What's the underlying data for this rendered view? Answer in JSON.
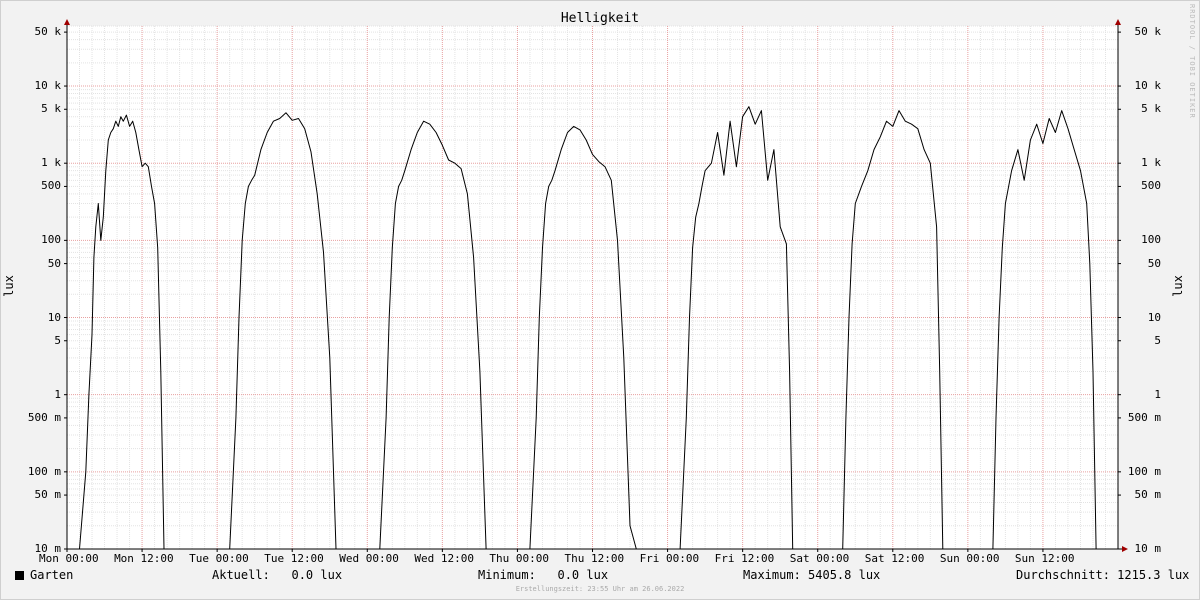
{
  "chart_data": {
    "type": "line",
    "title": "Helligkeit",
    "ylabel": "lux",
    "yscale": "log",
    "ylim": [
      0.01,
      60000
    ],
    "grid": true,
    "x_ticks": [
      "Mon 00:00",
      "Mon 12:00",
      "Tue 00:00",
      "Tue 12:00",
      "Wed 00:00",
      "Wed 12:00",
      "Thu 00:00",
      "Thu 12:00",
      "Fri 00:00",
      "Fri 12:00",
      "Sat 00:00",
      "Sat 12:00",
      "Sun 00:00",
      "Sun 12:00"
    ],
    "y_ticks": [
      {
        "value": 50000,
        "label": "50 k"
      },
      {
        "value": 10000,
        "label": "10 k"
      },
      {
        "value": 5000,
        "label": "5 k"
      },
      {
        "value": 1000,
        "label": "1 k"
      },
      {
        "value": 500,
        "label": "500"
      },
      {
        "value": 100,
        "label": "100"
      },
      {
        "value": 50,
        "label": "50"
      },
      {
        "value": 10,
        "label": "10"
      },
      {
        "value": 5,
        "label": "5"
      },
      {
        "value": 1,
        "label": "1"
      },
      {
        "value": 0.5,
        "label": "500 m"
      },
      {
        "value": 0.1,
        "label": "100 m"
      },
      {
        "value": 0.05,
        "label": "50 m"
      },
      {
        "value": 0.01,
        "label": "10 m"
      }
    ],
    "series": [
      {
        "name": "Garten",
        "color": "#000000",
        "x_hours": [
          0,
          2,
          3,
          3.5,
          4,
          4.3,
          4.6,
          5,
          5.4,
          5.8,
          6.2,
          6.6,
          7,
          7.4,
          7.8,
          8.2,
          8.6,
          9,
          9.5,
          10,
          10.5,
          11,
          11.5,
          12,
          12.5,
          13,
          13.5,
          14,
          14.5,
          15,
          15.5,
          16,
          16.5,
          17,
          17.5,
          18,
          18.5,
          19,
          19.5,
          20,
          20.5,
          21,
          21.5,
          22,
          26,
          27,
          27.5,
          28,
          28.5,
          29,
          29.5,
          30,
          31,
          32,
          33,
          34,
          35,
          36,
          37,
          38,
          39,
          40,
          41,
          42,
          43,
          43.5,
          44,
          44.5,
          45,
          45.5,
          46,
          50,
          51,
          51.5,
          52,
          52.5,
          53,
          53.5,
          54,
          55,
          56,
          57,
          58,
          59,
          60,
          61,
          62,
          63,
          64,
          65,
          66,
          67,
          67.5,
          68,
          68.5,
          69,
          69.5,
          70,
          74,
          75,
          75.5,
          76,
          76.5,
          77,
          77.5,
          78,
          79,
          80,
          81,
          82,
          83,
          84,
          85,
          86,
          87,
          88,
          89,
          90,
          91,
          91.5,
          92,
          92.5,
          93,
          93.5,
          94,
          98,
          99,
          99.5,
          100,
          100.5,
          101,
          101.5,
          102,
          103,
          104,
          105,
          106,
          107,
          108,
          109,
          110,
          111,
          112,
          113,
          114,
          115,
          115.5,
          116,
          116.5,
          117,
          117.5,
          118,
          122,
          123,
          123.5,
          124,
          124.5,
          125,
          125.5,
          126,
          127,
          128,
          129,
          130,
          131,
          132,
          133,
          134,
          135,
          136,
          137,
          138,
          139,
          139.5,
          140,
          140.5,
          141,
          141.5,
          142,
          146,
          147,
          147.5,
          148,
          148.5,
          149,
          149.5,
          150,
          151,
          152,
          153,
          154,
          155,
          156,
          157,
          158,
          159,
          160,
          161,
          162,
          163,
          163.5,
          164,
          164.5,
          165,
          165.5,
          166,
          167
        ],
        "values": [
          0.01,
          0.01,
          0.1,
          1,
          6,
          60,
          150,
          300,
          100,
          200,
          800,
          2000,
          2500,
          2800,
          3500,
          3000,
          4000,
          3500,
          4200,
          3000,
          3500,
          2500,
          1500,
          900,
          1000,
          900,
          500,
          300,
          80,
          2,
          0.01,
          0.01,
          0.01,
          0.01,
          0.01,
          0.01,
          0.01,
          0.01,
          0.01,
          0.01,
          0.01,
          0.01,
          0.01,
          0.01,
          0.01,
          0.5,
          10,
          100,
          300,
          500,
          600,
          700,
          1500,
          2500,
          3500,
          3800,
          4500,
          3600,
          3800,
          2800,
          1400,
          400,
          70,
          3,
          0.01,
          0.01,
          0.01,
          0.01,
          0.01,
          0.01,
          0.01,
          0.01,
          0.5,
          10,
          80,
          300,
          500,
          600,
          800,
          1500,
          2500,
          3500,
          3200,
          2500,
          1700,
          1100,
          1000,
          850,
          400,
          60,
          2,
          0.01,
          0.01,
          0.01,
          0.01,
          0.01,
          0.01,
          0.01,
          0.01,
          0.5,
          10,
          80,
          300,
          500,
          600,
          800,
          1500,
          2500,
          3000,
          2700,
          2000,
          1300,
          1050,
          900,
          600,
          100,
          3,
          0.02,
          0.01,
          0.01,
          0.01,
          0.01,
          0.01,
          0.01,
          0.01,
          0.01,
          0.5,
          10,
          80,
          200,
          300,
          500,
          800,
          1000,
          2500,
          700,
          3500,
          900,
          4000,
          5400,
          3200,
          4800,
          600,
          1500,
          150,
          90,
          2,
          0.01,
          0.01,
          0.01,
          0.01,
          0.01,
          0.01,
          0.01,
          0.01,
          0.01,
          0.5,
          10,
          90,
          300,
          500,
          800,
          1500,
          2200,
          3500,
          3000,
          4800,
          3500,
          3200,
          2800,
          1500,
          1000,
          150,
          2,
          0.01,
          0.01,
          0.01,
          0.01,
          0.01,
          0.01,
          0.01,
          0.01,
          0.01,
          0.5,
          10,
          80,
          300,
          800,
          1500,
          600,
          2000,
          3200,
          1800,
          3800,
          2500,
          4800,
          2800,
          1500,
          800,
          300,
          50,
          2,
          0.01,
          0.01,
          0.01,
          0.01,
          0.01,
          0.01,
          0.01,
          0.01
        ]
      }
    ]
  },
  "legend": {
    "series_name": "Garten",
    "current": "Aktuell:   0.0 lux",
    "minimum": "Minimum:   0.0 lux",
    "maximum": "Maximum: 5405.8 lux",
    "average": "Durchschnitt: 1215.3 lux"
  },
  "unit_left": "lux",
  "unit_right": "lux",
  "watermark": "RRDTOOL / TOBI OETIKER",
  "footer": "Erstellungszeit: 23:55 Uhr am 26.06.2022"
}
